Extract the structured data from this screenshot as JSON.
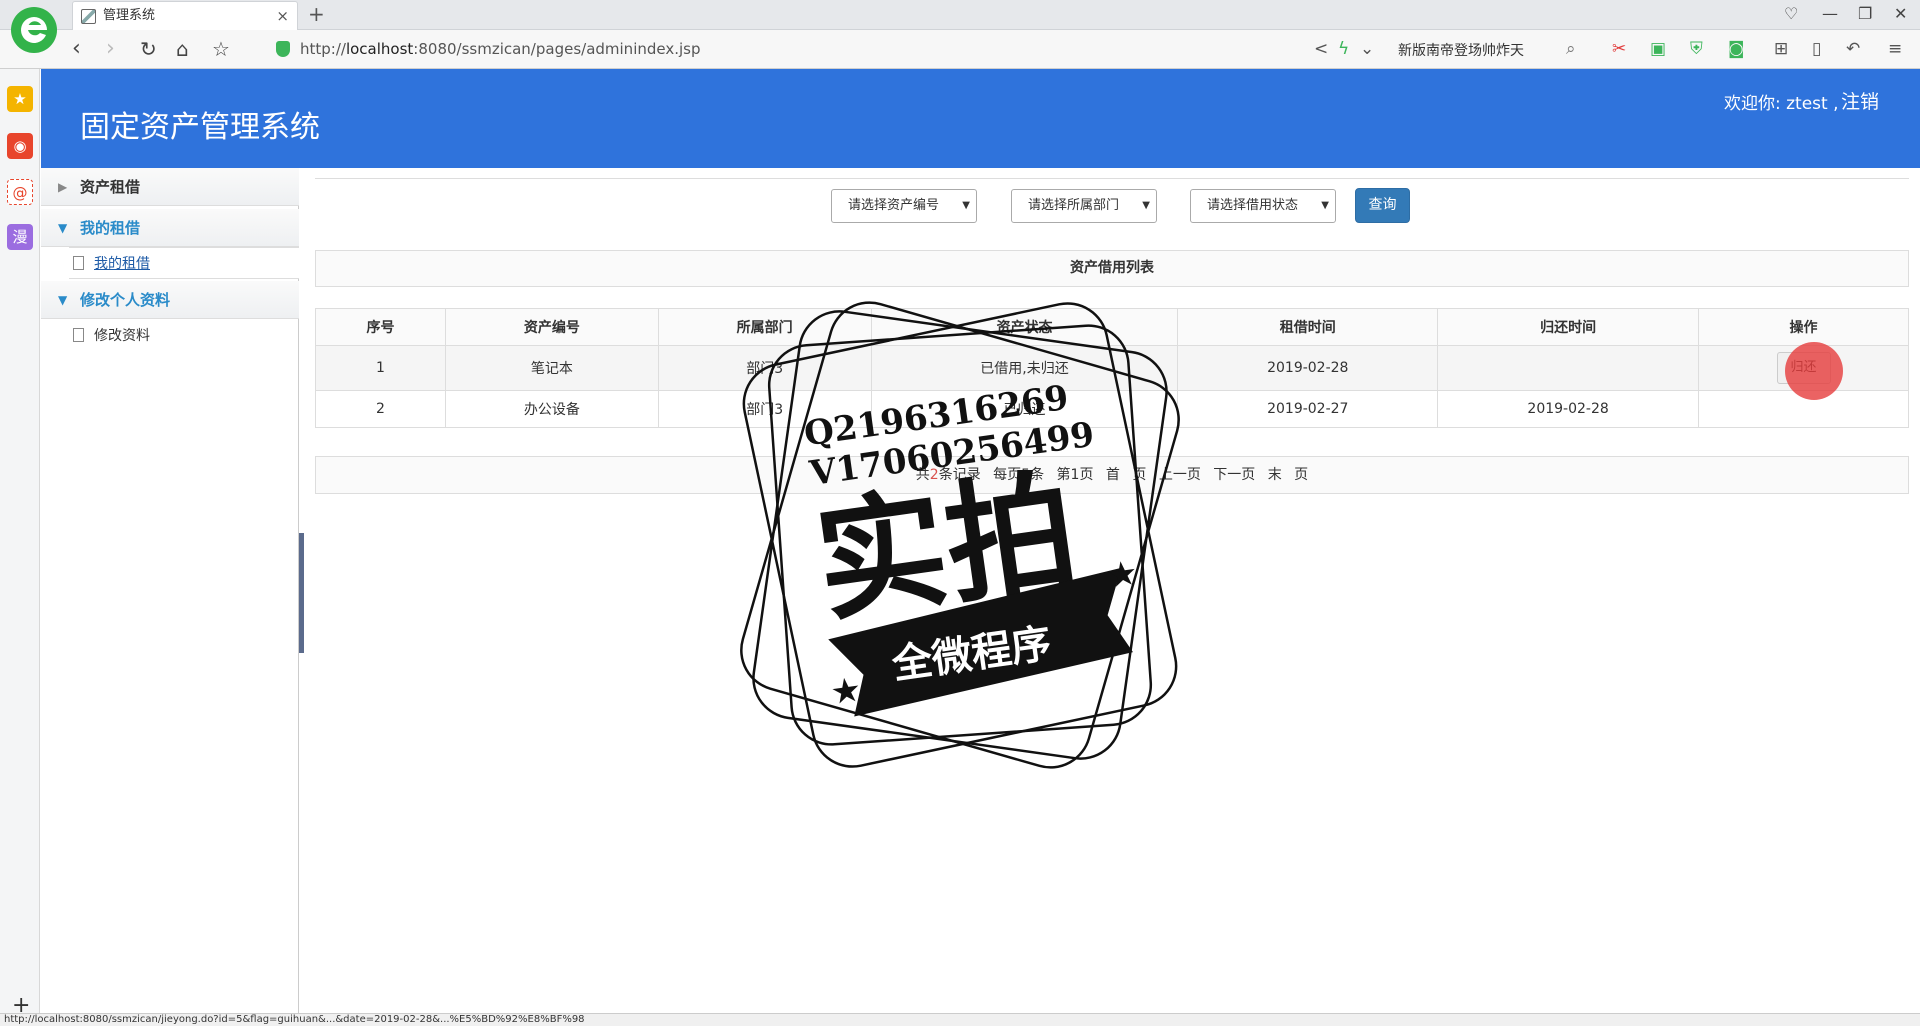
{
  "browser": {
    "tab_title": "管理系统",
    "url_prefix": "http://",
    "url_host": "localhost",
    "url_rest": ":8080/ssmzican/pages/adminindex.jsp",
    "search_text": "新版南帝登场帅炸天",
    "status_text": "http://localhost:8080/ssmzican/jieyong.do?id=5&flag=guihuan&...&date=2019-02-28&...%E5%BD%92%E8%BF%98",
    "accent": "#2f73dc"
  },
  "app": {
    "title": "固定资产管理系统",
    "welcome": "欢迎你: ztest ,",
    "logout": "注销"
  },
  "sidebar": {
    "groups": [
      {
        "label": "资产租借",
        "open": false
      },
      {
        "label": "我的租借",
        "open": true,
        "items": [
          "我的租借"
        ]
      },
      {
        "label": "修改个人资料",
        "open": true,
        "items": [
          "修改资料"
        ]
      }
    ]
  },
  "filters": {
    "asset_no": "请选择资产编号",
    "department": "请选择所属部门",
    "borrow_status": "请选择借用状态",
    "query": "查询"
  },
  "list": {
    "title": "资产借用列表",
    "columns": [
      "序号",
      "资产编号",
      "所属部门",
      "资产状态",
      "租借时间",
      "归还时间",
      "操作"
    ],
    "rows": [
      {
        "index": "1",
        "asset": "笔记本",
        "dept": "部门3",
        "status": "已借用,未归还",
        "borrow": "2019-02-28",
        "return": "",
        "action": "归还"
      },
      {
        "index": "2",
        "asset": "办公设备",
        "dept": "部门3",
        "status": "已归还",
        "borrow": "2019-02-27",
        "return": "2019-02-28",
        "action": ""
      }
    ]
  },
  "pager": {
    "total_prefix": "共",
    "total_count": "2",
    "total_suffix": "条记录",
    "per_page": "每页5条",
    "page_info": "第1页",
    "first": "首 页",
    "prev": "上一页",
    "next": "下一页",
    "last": "末 页"
  },
  "watermark": {
    "line1": "Q2196316269",
    "line2": "V17060256499",
    "big": "实拍",
    "ribbon": "全微程序"
  }
}
